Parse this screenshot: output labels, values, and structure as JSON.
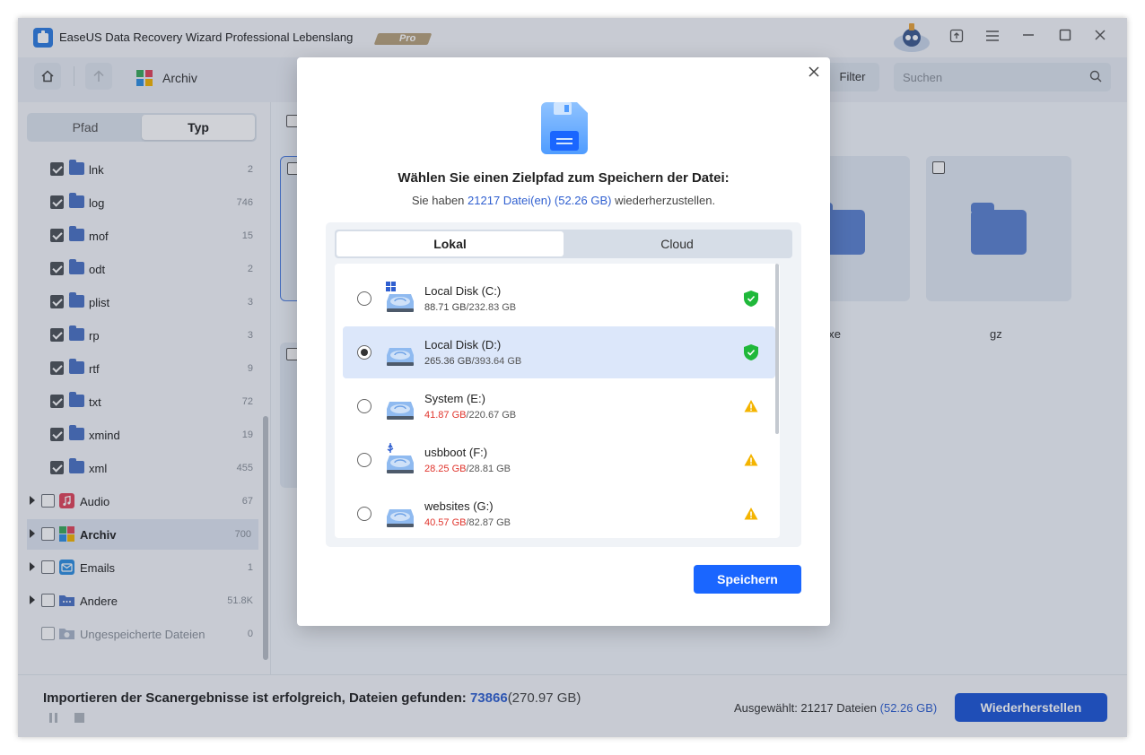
{
  "app": {
    "title": "EaseUS Data Recovery Wizard Professional Lebenslang",
    "badge": "Pro"
  },
  "toolbar": {
    "breadcrumb": "Archiv",
    "filter_label": "Filter",
    "search_placeholder": "Suchen"
  },
  "sidebar": {
    "view_tabs": [
      "Pfad",
      "Typ"
    ],
    "active_tab": "Typ",
    "items": [
      {
        "label": "lnk",
        "count": "2",
        "checked": true
      },
      {
        "label": "log",
        "count": "746",
        "checked": true
      },
      {
        "label": "mof",
        "count": "15",
        "checked": true
      },
      {
        "label": "odt",
        "count": "2",
        "checked": true
      },
      {
        "label": "plist",
        "count": "3",
        "checked": true
      },
      {
        "label": "rp",
        "count": "3",
        "checked": true
      },
      {
        "label": "rtf",
        "count": "9",
        "checked": true
      },
      {
        "label": "txt",
        "count": "72",
        "checked": true
      },
      {
        "label": "xmind",
        "count": "19",
        "checked": true
      },
      {
        "label": "xml",
        "count": "455",
        "checked": true
      }
    ],
    "categories": [
      {
        "label": "Audio",
        "count": "67",
        "icon": "music-icon",
        "color": "#e0455a"
      },
      {
        "label": "Archiv",
        "count": "700",
        "icon": "archive-icon",
        "color": "#3aa85a"
      },
      {
        "label": "Emails",
        "count": "1",
        "icon": "mail-icon",
        "color": "#2f8fe0"
      },
      {
        "label": "Andere",
        "count": "51.8K",
        "icon": "folder-icon",
        "color": "#4b73c4"
      },
      {
        "label": "Ungespeicherte Dateien",
        "count": "0",
        "icon": "unsaved-folder-icon",
        "color": "#a9b5c8"
      }
    ]
  },
  "content": {
    "tile_labels": [
      "exe",
      "gz"
    ]
  },
  "modal": {
    "title": "Wählen Sie einen Zielpfad zum Speichern der Datei:",
    "subtitle_prefix": "Sie haben",
    "subtitle_highlight": "21217 Datei(en) (52.26 GB)",
    "subtitle_suffix": "wiederherzustellen.",
    "tabs": [
      "Lokal",
      "Cloud"
    ],
    "active_tab": "Lokal",
    "disks": [
      {
        "name": "Local Disk (C:)",
        "free": "88.71 GB",
        "total": "/232.83 GB",
        "status": "ok",
        "selected": false,
        "icon": "windows-drive-icon"
      },
      {
        "name": "Local Disk (D:)",
        "free": "265.36 GB",
        "total": "/393.64 GB",
        "status": "ok",
        "selected": true,
        "icon": "drive-icon"
      },
      {
        "name": "System (E:)",
        "free": "41.87 GB",
        "total": "/220.67 GB",
        "status": "warning",
        "selected": false,
        "icon": "drive-icon"
      },
      {
        "name": "usbboot (F:)",
        "free": "28.25 GB",
        "total": "/28.81 GB",
        "status": "warning",
        "selected": false,
        "icon": "usb-drive-icon"
      },
      {
        "name": "websites (G:)",
        "free": "40.57 GB",
        "total": "/82.87 GB",
        "status": "warning",
        "selected": false,
        "icon": "drive-icon"
      }
    ],
    "save_label": "Speichern"
  },
  "bottom": {
    "status_prefix": "Importieren der Scanergebnisse ist erfolgreich, Dateien gefunden:",
    "found_count": "73866",
    "found_size": "(270.97 GB)",
    "selected_prefix": "Ausgewählt: 21217 Dateien",
    "selected_size": "(52.26 GB)",
    "recover_label": "Wiederherstellen"
  },
  "colors": {
    "accent": "#1a66ff",
    "ok": "#1fb83a",
    "warning": "#f4b400",
    "low_space": "#e0342c"
  }
}
